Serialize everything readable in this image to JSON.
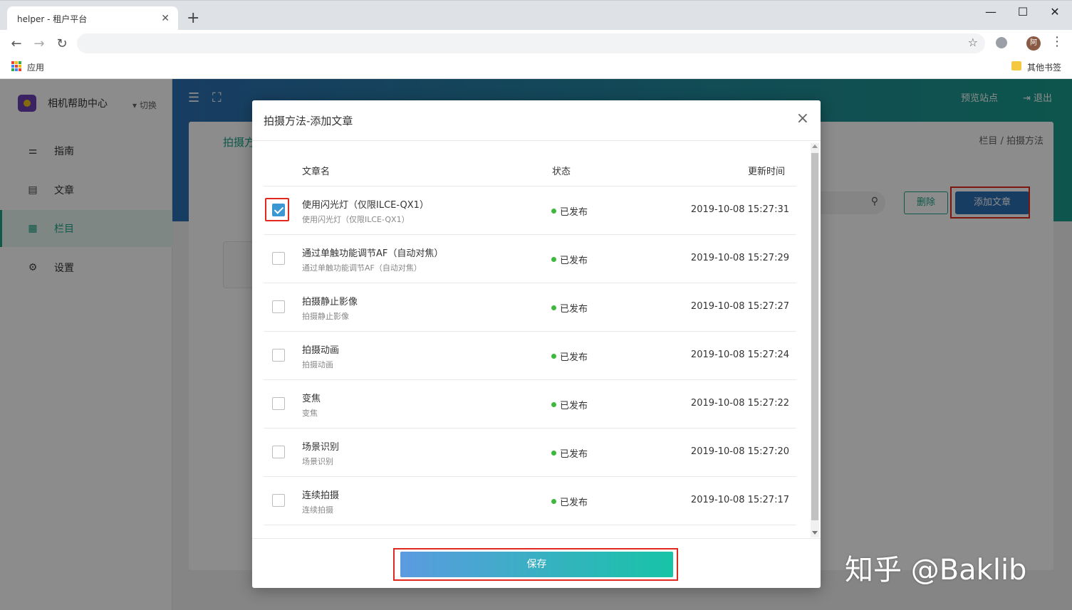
{
  "browser": {
    "tab_title": "helper - 租户平台",
    "tab_close": "✕",
    "new_tab": "+",
    "win_minimize": "—",
    "win_maximize": "☐",
    "win_close": "✕",
    "back": "←",
    "forward": "→",
    "reload": "↻",
    "star": "☆",
    "avatar_text": "阿",
    "menu": "⋮",
    "bookmarks": {
      "apps": "应用",
      "other": "其他书签"
    }
  },
  "sidebar": {
    "brand": "相机帮助中心",
    "switch": "▾ 切换",
    "items": [
      {
        "label": "指南",
        "icon": "sliders-icon"
      },
      {
        "label": "文章",
        "icon": "document-icon"
      },
      {
        "label": "栏目",
        "icon": "grid-icon"
      },
      {
        "label": "设置",
        "icon": "gear-icon"
      }
    ]
  },
  "header": {
    "preview": "预览站点",
    "logout": "⇥ 退出"
  },
  "content": {
    "title": "拍摄方",
    "breadcrumb": "栏目 / 拍摄方法",
    "delete_btn": "删除",
    "add_btn": "添加文章"
  },
  "modal": {
    "title": "拍摄方法-添加文章",
    "close": "×",
    "columns": {
      "name": "文章名",
      "status": "状态",
      "updated": "更新时间"
    },
    "rows": [
      {
        "title": "使用闪光灯（仅限ILCE-QX1）",
        "subtitle": "使用闪光灯（仅限ILCE-QX1）",
        "status": "已发布",
        "time": "2019-10-08 15:27:31",
        "checked": true
      },
      {
        "title": "通过单触功能调节AF（自动对焦）",
        "subtitle": "通过单触功能调节AF（自动对焦）",
        "status": "已发布",
        "time": "2019-10-08 15:27:29",
        "checked": false
      },
      {
        "title": "拍摄静止影像",
        "subtitle": "拍摄静止影像",
        "status": "已发布",
        "time": "2019-10-08 15:27:27",
        "checked": false
      },
      {
        "title": "拍摄动画",
        "subtitle": "拍摄动画",
        "status": "已发布",
        "time": "2019-10-08 15:27:24",
        "checked": false
      },
      {
        "title": "变焦",
        "subtitle": "变焦",
        "status": "已发布",
        "time": "2019-10-08 15:27:22",
        "checked": false
      },
      {
        "title": "场景识别",
        "subtitle": "场景识别",
        "status": "已发布",
        "time": "2019-10-08 15:27:20",
        "checked": false
      },
      {
        "title": "连续拍摄",
        "subtitle": "连续拍摄",
        "status": "已发布",
        "time": "2019-10-08 15:27:17",
        "checked": false
      }
    ],
    "save_btn": "保存"
  },
  "watermark": "知乎 @Baklib",
  "colors": {
    "accent": "#1aa383",
    "primary": "#2c6fb2",
    "highlight": "#e0281f",
    "status_dot": "#3cb93c"
  }
}
